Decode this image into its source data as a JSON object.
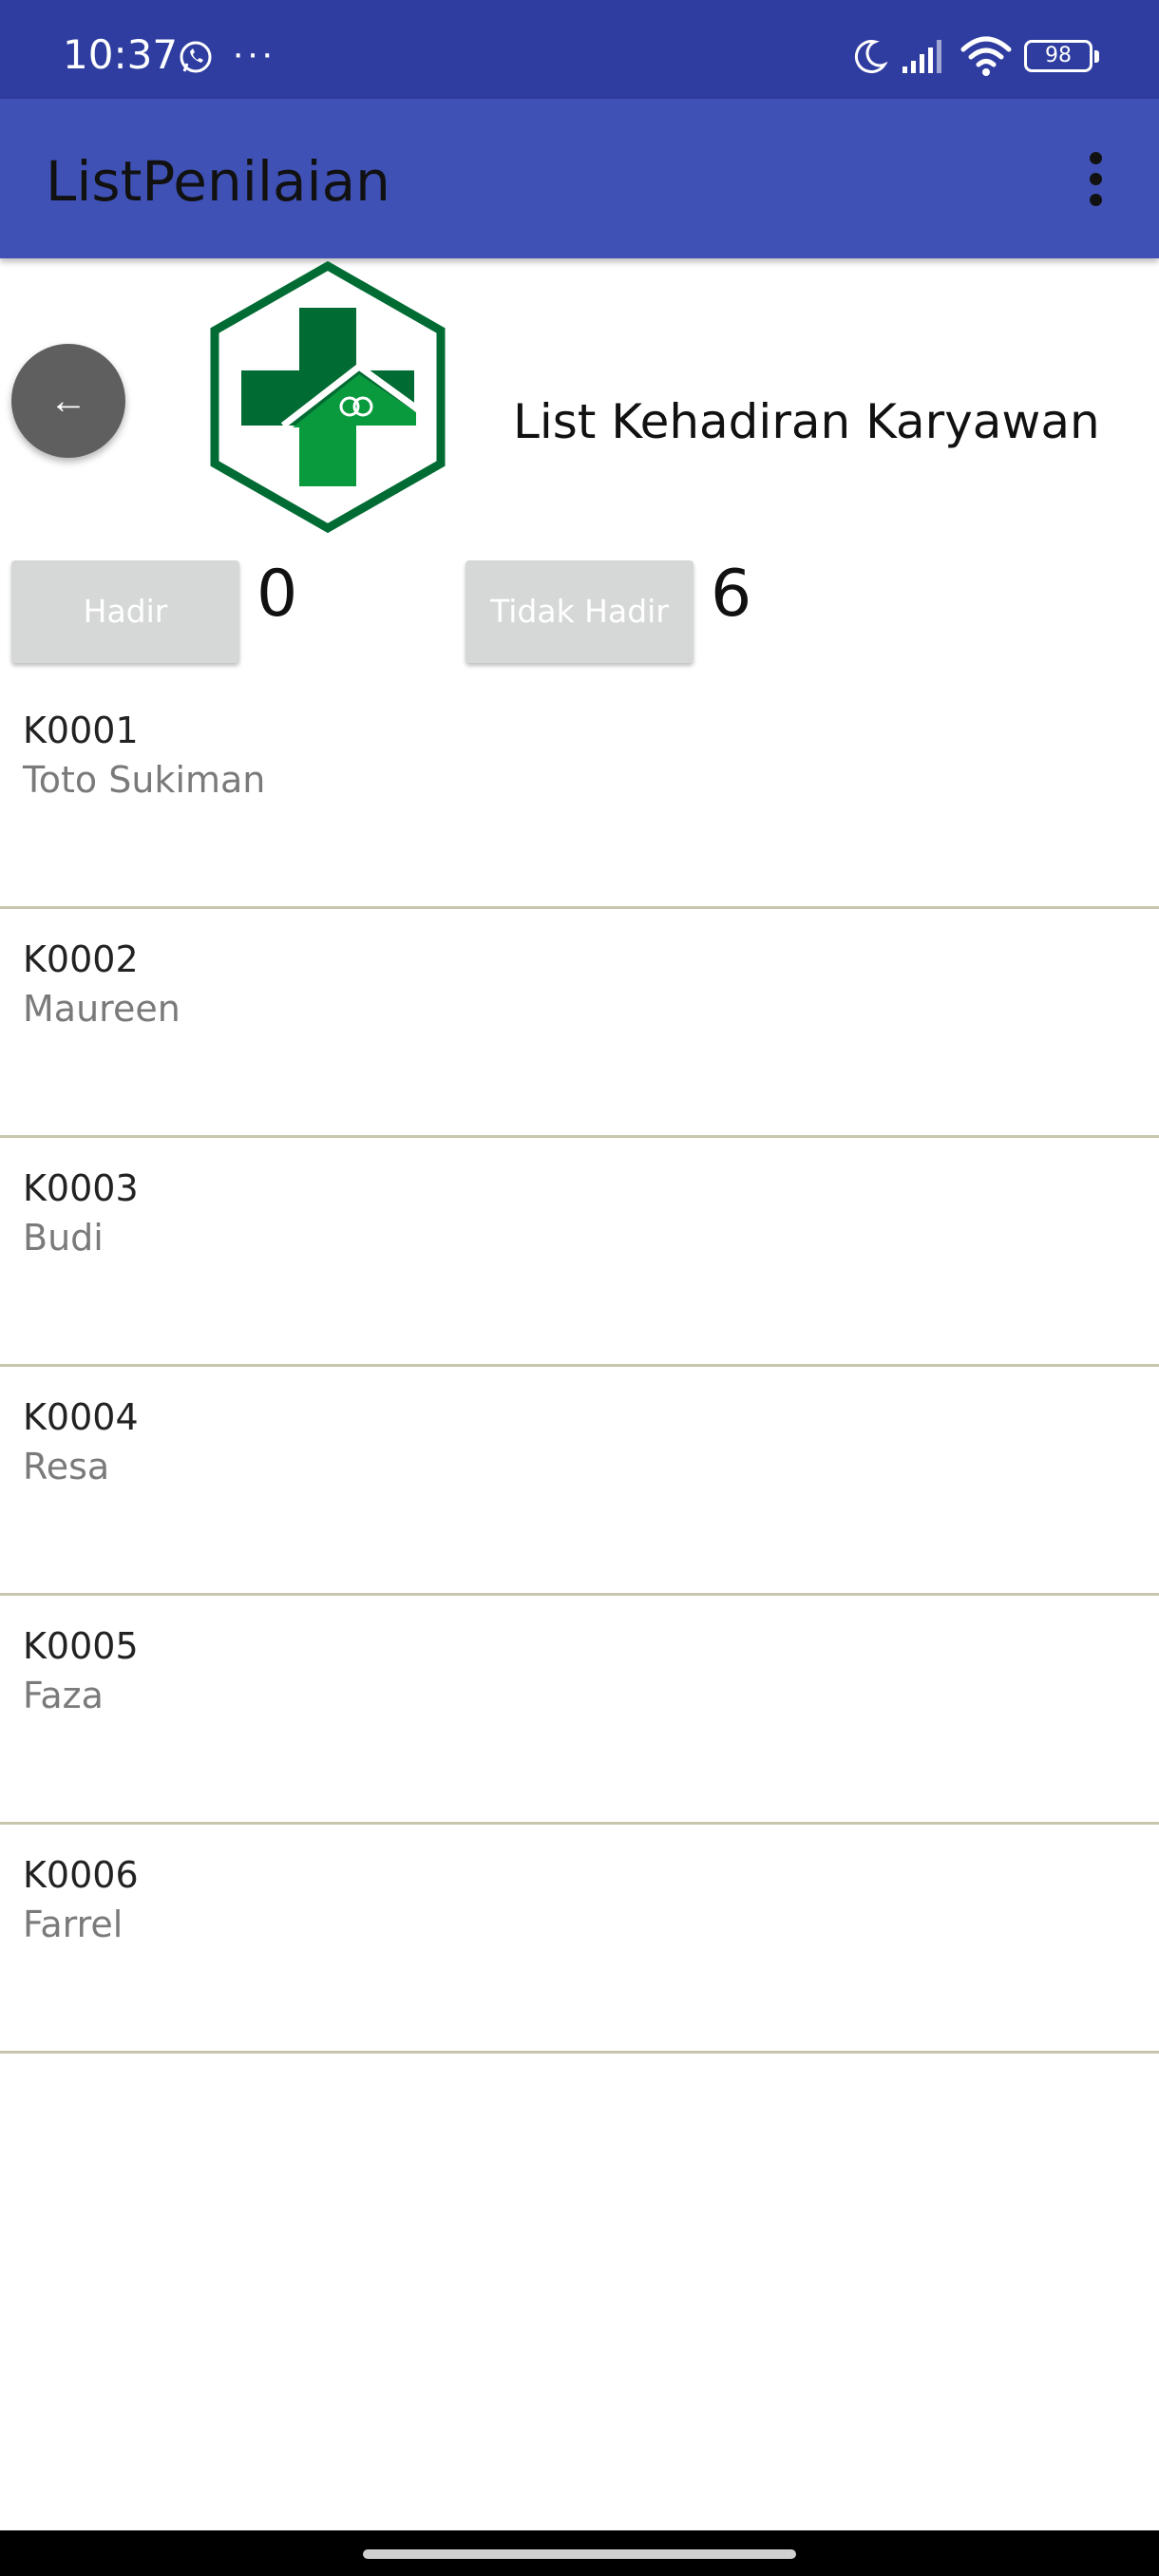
{
  "status_bar": {
    "time": "10:37",
    "notification_dots": "···",
    "battery": "98",
    "icons": [
      "whatsapp-icon",
      "moon-icon",
      "signal-icon",
      "wifi-icon",
      "battery-icon"
    ]
  },
  "app_bar": {
    "title": "ListPenilaian",
    "menu_icon": "more-vert-icon"
  },
  "header": {
    "back_icon": "←",
    "heading": "List Kehadiran Karyawan",
    "logo_icon": "health-cross-logo"
  },
  "attendance": {
    "present_label": "Hadir",
    "present_count": "0",
    "absent_label": "Tidak Hadir",
    "absent_count": "6"
  },
  "employees": [
    {
      "code": "K0001",
      "name": "Toto Sukiman"
    },
    {
      "code": "K0002",
      "name": "Maureen"
    },
    {
      "code": "K0003",
      "name": "Budi"
    },
    {
      "code": "K0004",
      "name": "Resa"
    },
    {
      "code": "K0005",
      "name": "Faza"
    },
    {
      "code": "K0006",
      "name": "Farrel"
    }
  ],
  "colors": {
    "status_bar": "#2f3da0",
    "app_bar": "#3f51b5",
    "logo_green_dark": "#006b32",
    "logo_green_light": "#0a9a3e",
    "button_gray": "#d6d7d7",
    "fab_gray": "#5f5f5f"
  }
}
